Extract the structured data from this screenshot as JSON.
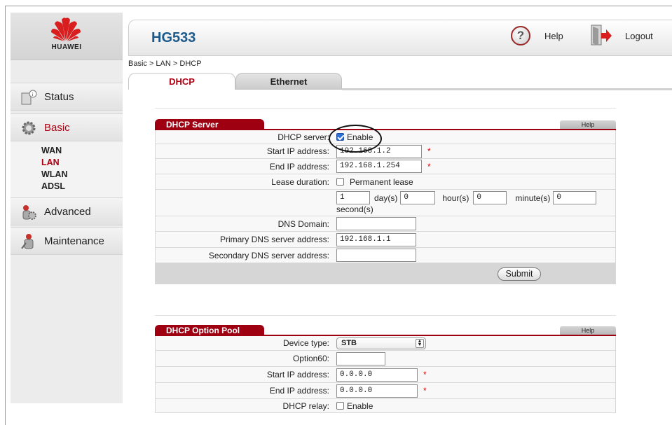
{
  "brand": {
    "logo_text": "HUAWEI",
    "model": "HG533"
  },
  "header": {
    "help_icon": "?",
    "help_label": "Help",
    "logout_label": "Logout"
  },
  "breadcrumb": "Basic > LAN > DHCP",
  "tabs": [
    {
      "label": "DHCP",
      "active": true
    },
    {
      "label": "Ethernet",
      "active": false
    }
  ],
  "sidebar": {
    "items": [
      {
        "label": "Status",
        "icon": "status-icon"
      },
      {
        "label": "Basic",
        "icon": "gear-icon",
        "active": true
      },
      {
        "label": "Advanced",
        "icon": "advanced-icon"
      },
      {
        "label": "Maintenance",
        "icon": "maintenance-icon"
      }
    ],
    "basic_sub": [
      {
        "label": "WAN"
      },
      {
        "label": "LAN",
        "active": true
      },
      {
        "label": "WLAN"
      },
      {
        "label": "ADSL"
      }
    ]
  },
  "dhcp_server": {
    "title": "DHCP Server",
    "help": "Help",
    "server_label": "DHCP server:",
    "enable_label": "Enable",
    "enabled": true,
    "start_ip_label": "Start IP address:",
    "start_ip": "192.168.1.2",
    "end_ip_label": "End IP address:",
    "end_ip": "192.168.1.254",
    "lease_label": "Lease duration:",
    "permanent_label": "Permanent lease",
    "permanent": false,
    "days": "1",
    "days_label": "day(s)",
    "hours": "0",
    "hours_label": "hour(s)",
    "minutes": "0",
    "minutes_label": "minute(s)",
    "seconds": "0",
    "seconds_label": "second(s)",
    "dns_domain_label": "DNS Domain:",
    "dns_domain": "",
    "primary_dns_label": "Primary DNS server address:",
    "primary_dns": "192.168.1.1",
    "secondary_dns_label": "Secondary DNS server address:",
    "secondary_dns": "",
    "required_mark": "*",
    "submit_label": "Submit"
  },
  "option_pool": {
    "title": "DHCP Option Pool",
    "help": "Help",
    "device_type_label": "Device type:",
    "device_type": "STB",
    "option60_label": "Option60:",
    "option60": "",
    "start_ip_label": "Start IP address:",
    "start_ip": "0.0.0.0",
    "end_ip_label": "End IP address:",
    "end_ip": "0.0.0.0",
    "relay_label": "DHCP relay:",
    "relay_enable_label": "Enable",
    "relay_enabled": false
  },
  "colors": {
    "accent": "#9e0012",
    "model": "#1c5a8c",
    "required": "#ee0000"
  }
}
